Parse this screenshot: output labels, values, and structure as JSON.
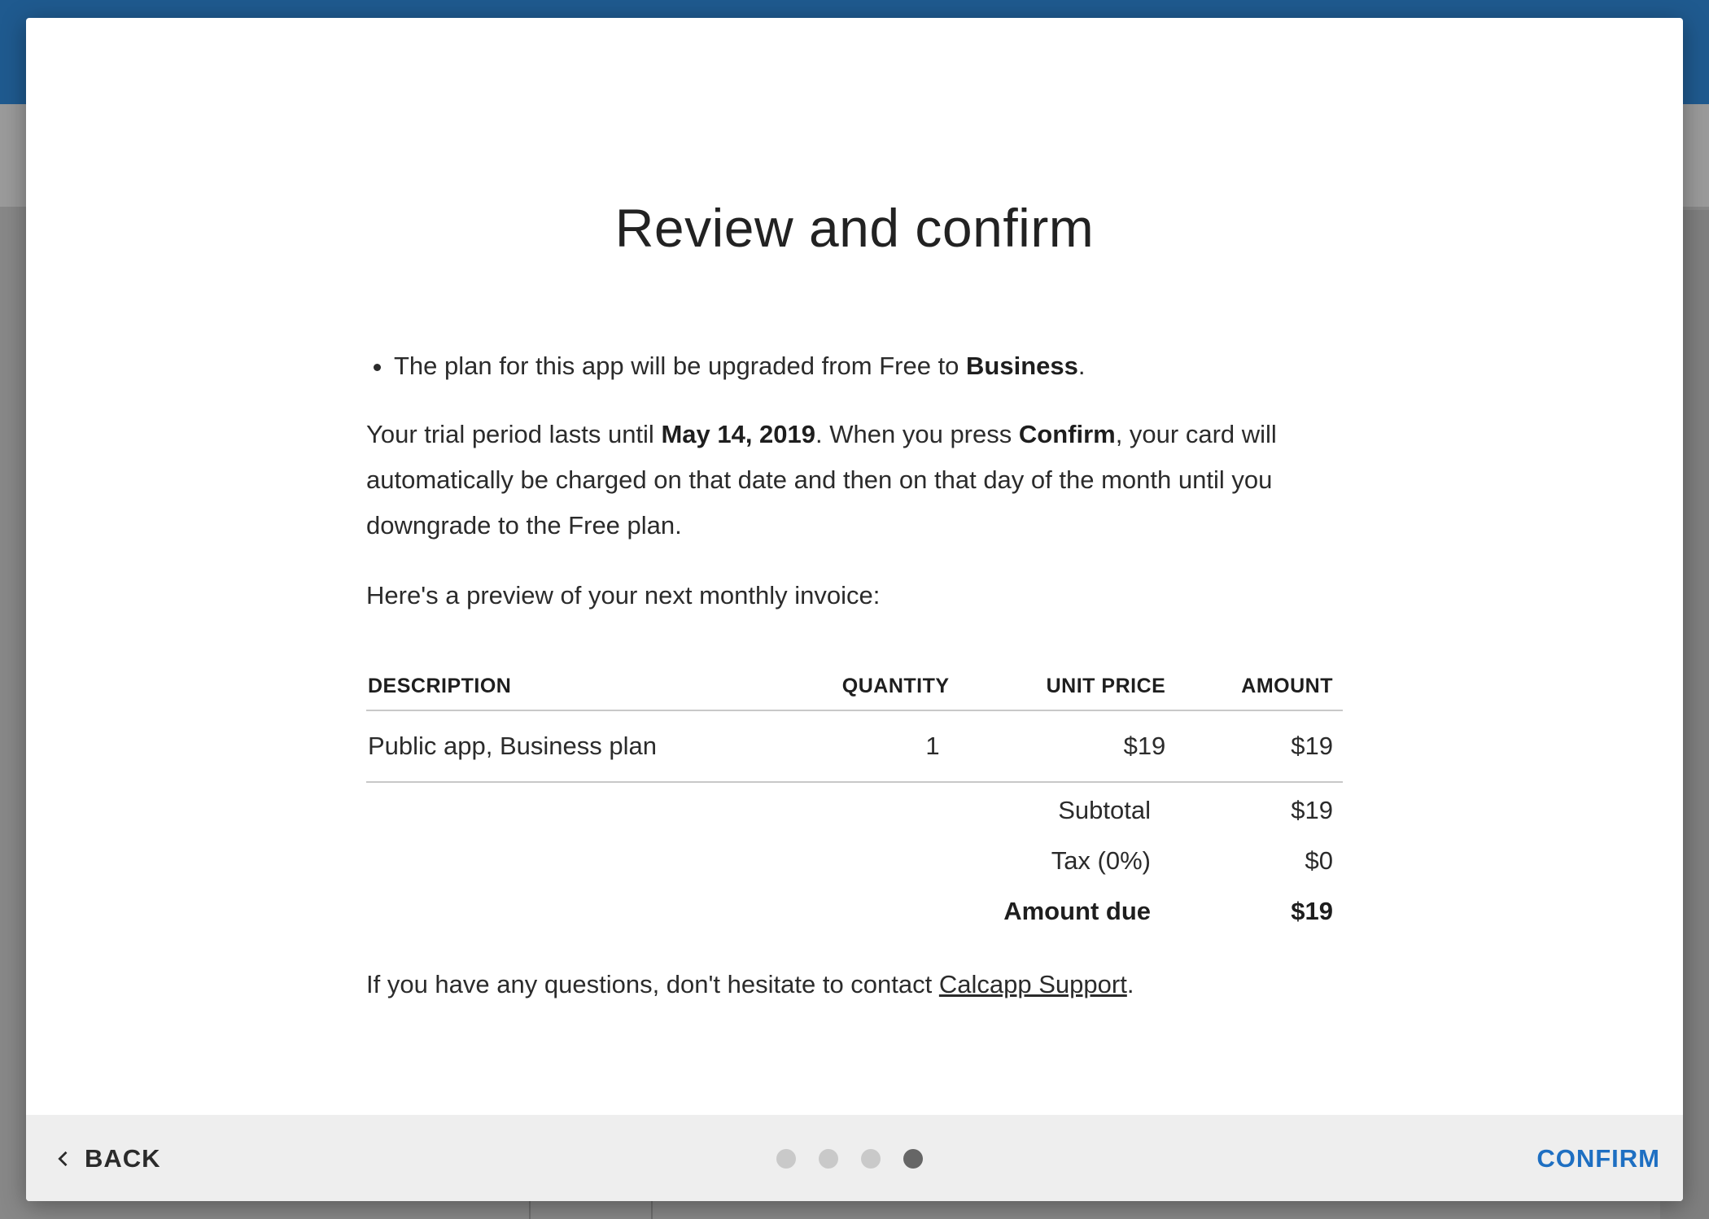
{
  "dialog": {
    "title": "Review and confirm",
    "bullet": {
      "prefix": "The plan for this app will be upgraded from Free to ",
      "plan": "Business",
      "suffix": "."
    },
    "trial": {
      "part1": "Your trial period lasts until ",
      "date": "May 14, 2019",
      "part2": ". When you press ",
      "confirm_word": "Confirm",
      "part3": ", your card will automatically be charged on that date and then on that day of the month until you downgrade to the Free plan."
    },
    "preview_text": "Here's a preview of your next monthly invoice:",
    "invoice": {
      "headers": {
        "description": "DESCRIPTION",
        "quantity": "QUANTITY",
        "unit_price": "UNIT PRICE",
        "amount": "AMOUNT"
      },
      "rows": [
        {
          "description": "Public app, Business plan",
          "quantity": "1",
          "unit_price": "$19",
          "amount": "$19"
        }
      ],
      "subtotal_label": "Subtotal",
      "subtotal_value": "$19",
      "tax_label": "Tax (0%)",
      "tax_value": "$0",
      "amount_due_label": "Amount due",
      "amount_due_value": "$19"
    },
    "contact": {
      "prefix": "If you have any questions, don't hesitate to contact ",
      "link": "Calcapp Support",
      "suffix": "."
    }
  },
  "footer": {
    "back_label": "BACK",
    "confirm_label": "CONFIRM",
    "steps_total": 4,
    "steps_current": 4
  },
  "colors": {
    "accent": "#1e6fc2",
    "topbar": "#1f5a8f",
    "footer_bg": "#eeeeee"
  }
}
